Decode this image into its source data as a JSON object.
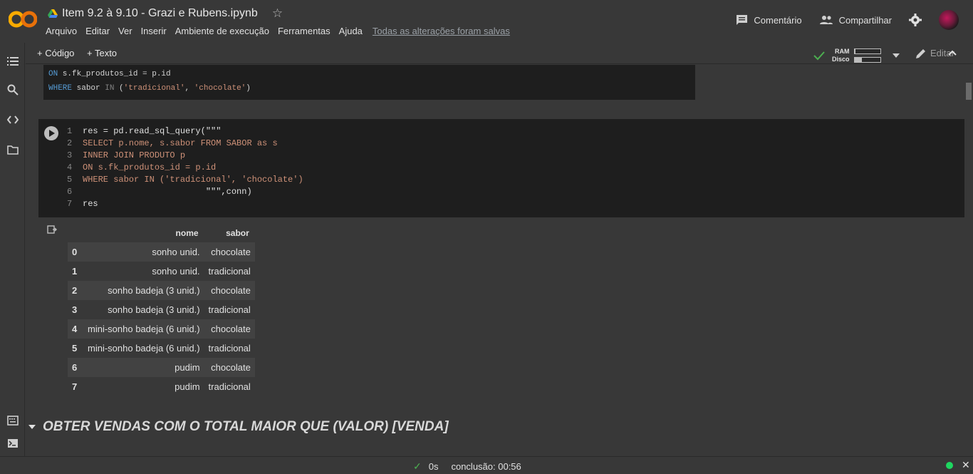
{
  "header": {
    "doc_title": "Item 9.2 à 9.10 - Grazi e Rubens.ipynb",
    "menu": [
      "Arquivo",
      "Editar",
      "Ver",
      "Inserir",
      "Ambiente de execução",
      "Ferramentas",
      "Ajuda"
    ],
    "saved_status": "Todas as alterações foram salvas",
    "comment_label": "Comentário",
    "share_label": "Compartilhar"
  },
  "toolbar": {
    "add_code_label": "+ Código",
    "add_text_label": "+ Texto",
    "ram_label": "RAM",
    "disk_label": "Disco",
    "ram_fraction": 0.05,
    "disk_fraction": 0.3,
    "edit_label": "Editar"
  },
  "prev_cell": {
    "line1_kw": "ON",
    "line1_rest": " s.fk_produtos_id = p.id",
    "line2_kw": "WHERE",
    "line2_mid": " sabor ",
    "line2_in": "IN",
    "line2_rest": " (",
    "line2_s1": "'tradicional'",
    "line2_sep": ", ",
    "line2_s2": "'chocolate'",
    "line2_end": ")"
  },
  "code_cell": {
    "lines": [
      {
        "n": "1",
        "text": "res = pd.read_sql_query(\"\"\""
      },
      {
        "n": "2",
        "text": "SELECT p.nome, s.sabor FROM SABOR as s"
      },
      {
        "n": "3",
        "text": "INNER JOIN PRODUTO p"
      },
      {
        "n": "4",
        "text": "ON s.fk_produtos_id = p.id"
      },
      {
        "n": "5",
        "text": "WHERE sabor IN ('tradicional', 'chocolate')"
      },
      {
        "n": "6",
        "text": "                        \"\"\",conn)"
      },
      {
        "n": "7",
        "text": "res"
      }
    ]
  },
  "output_table": {
    "columns": [
      "nome",
      "sabor"
    ],
    "rows": [
      {
        "idx": "0",
        "nome": "sonho unid.",
        "sabor": "chocolate"
      },
      {
        "idx": "1",
        "nome": "sonho unid.",
        "sabor": "tradicional"
      },
      {
        "idx": "2",
        "nome": "sonho badeja (3 unid.)",
        "sabor": "chocolate"
      },
      {
        "idx": "3",
        "nome": "sonho badeja (3 unid.)",
        "sabor": "tradicional"
      },
      {
        "idx": "4",
        "nome": "mini-sonho badeja (6 unid.)",
        "sabor": "chocolate"
      },
      {
        "idx": "5",
        "nome": "mini-sonho badeja (6 unid.)",
        "sabor": "tradicional"
      },
      {
        "idx": "6",
        "nome": "pudim",
        "sabor": "chocolate"
      },
      {
        "idx": "7",
        "nome": "pudim",
        "sabor": "tradicional"
      }
    ]
  },
  "section": {
    "title": "OBTER VENDAS COM O TOTAL MAIOR QUE (VALOR) [VENDA]"
  },
  "statusbar": {
    "duration": "0s",
    "completion": "conclusão: 00:56"
  }
}
